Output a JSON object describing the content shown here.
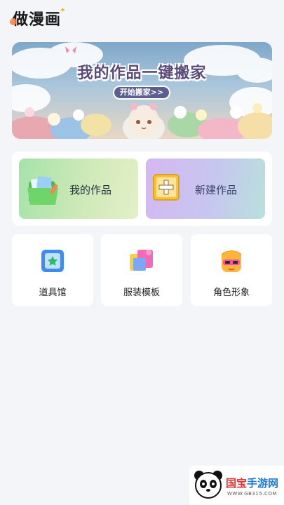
{
  "app": {
    "title": "做漫画"
  },
  "banner": {
    "title": "我的作品一键搬家",
    "button_label": "开始搬家>>"
  },
  "cards": {
    "my_works": "我的作品",
    "new_work": "新建作品"
  },
  "tools": [
    {
      "label": "道具馆",
      "icon": "prop-frame-icon"
    },
    {
      "label": "服装模板",
      "icon": "costume-template-icon"
    },
    {
      "label": "角色形象",
      "icon": "character-avatar-icon"
    }
  ],
  "watermark": {
    "brand_a": "国宝",
    "brand_b": "手游网",
    "url": "WWW.GB315.COM"
  },
  "colors": {
    "accent_green": "#a5e3a8",
    "accent_purple": "#d4b7f2",
    "banner_button": "#5b5e8f"
  }
}
